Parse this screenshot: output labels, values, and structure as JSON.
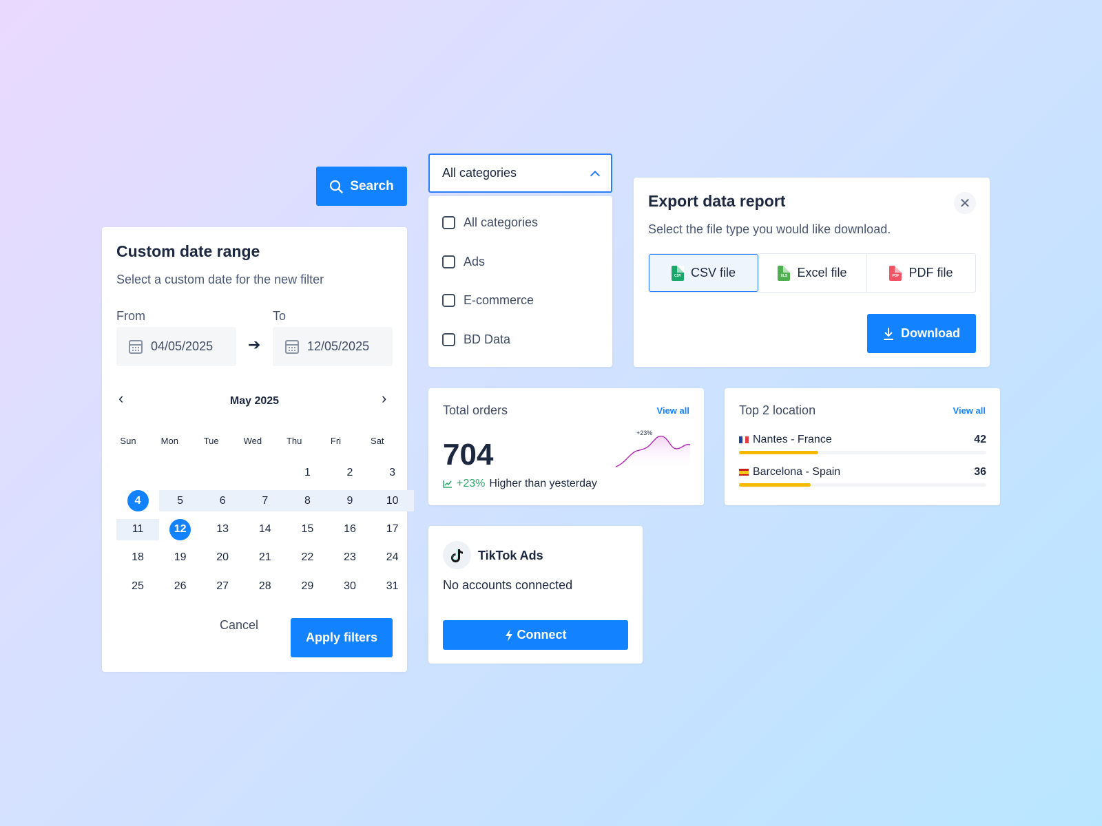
{
  "search": {
    "label": "Search"
  },
  "date_range": {
    "title": "Custom date range",
    "subtitle": "Select a custom date for the new filter",
    "from_label": "From",
    "to_label": "To",
    "from_value": "04/05/2025",
    "to_value": "12/05/2025",
    "month_label": "May 2025",
    "weekdays": [
      "Sun",
      "Mon",
      "Tue",
      "Wed",
      "Thu",
      "Fri",
      "Sat"
    ],
    "days": [
      "1",
      "2",
      "3",
      "4",
      "5",
      "6",
      "7",
      "8",
      "9",
      "10",
      "11",
      "12",
      "13",
      "14",
      "15",
      "16",
      "17",
      "18",
      "19",
      "20",
      "21",
      "22",
      "23",
      "24",
      "25",
      "26",
      "27",
      "28",
      "29",
      "30",
      "31"
    ],
    "selected_start": "4",
    "selected_end": "12",
    "cancel_label": "Cancel",
    "apply_label": "Apply filters"
  },
  "categories": {
    "selected": "All categories",
    "options": [
      "All categories",
      "Ads",
      "E-commerce",
      "BD Data"
    ]
  },
  "export": {
    "title": "Export data report",
    "subtitle": "Select the file type you would like download.",
    "file_types": [
      {
        "label": "CSV file",
        "badge": "CSV",
        "color": "#1aa86a",
        "active": true
      },
      {
        "label": "Excel file",
        "badge": "XLS",
        "color": "#4fb04f",
        "active": false
      },
      {
        "label": "PDF file",
        "badge": "PDF",
        "color": "#f05465",
        "active": false
      }
    ],
    "download_label": "Download",
    "close_icon": "close-icon"
  },
  "orders": {
    "label": "Total orders",
    "view_all": "View all",
    "value": "704",
    "change": "+23%",
    "change_text": "Higher than yesterday",
    "sparkline_label": "+23%",
    "sparkline_color": "#b12ab4"
  },
  "locations": {
    "label": "Top 2 location",
    "view_all": "View all",
    "items": [
      {
        "name": "Nantes - France",
        "count": "42",
        "share": 0.32
      },
      {
        "name": "Barcelona - Spain",
        "count": "36",
        "share": 0.29
      }
    ],
    "bar_color": "#f5b900"
  },
  "tiktok": {
    "title": "TikTok Ads",
    "status": "No accounts connected",
    "connect_label": "Connect"
  },
  "colors": {
    "primary": "#1282ff",
    "accent_border": "#2b7df7"
  }
}
